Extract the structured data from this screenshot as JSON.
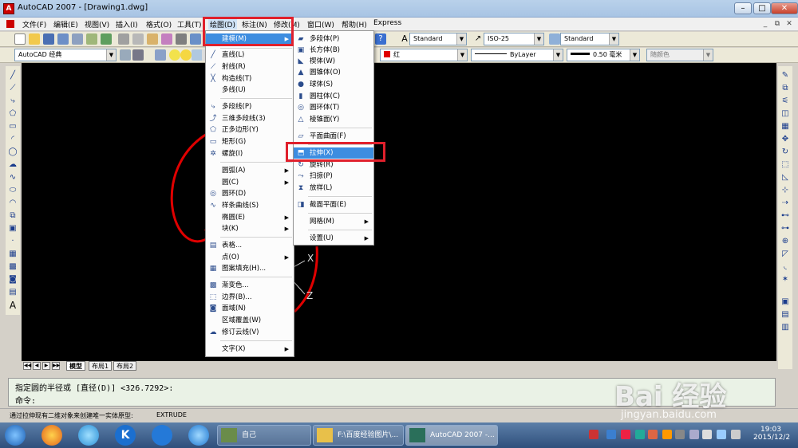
{
  "window": {
    "title": "AutoCAD 2007 - [Drawing1.dwg]",
    "app_icon": "A"
  },
  "menubar": {
    "items": [
      "文件(F)",
      "编辑(E)",
      "视图(V)",
      "插入(I)",
      "格式(O)",
      "工具(T)",
      "绘图(D)",
      "标注(N)",
      "修改(M)",
      "窗口(W)",
      "帮助(H)",
      "Express"
    ]
  },
  "toolbar2": {
    "text_style": "Standard",
    "dim_style": "ISO-25",
    "table_style": "Standard"
  },
  "toolbar3": {
    "workspace": "AutoCAD 经典",
    "color": "红",
    "linetype": "ByLayer",
    "lineweight": "0.50 毫米",
    "plotstyle": "随颜色",
    "colors": {
      "red_swatch": "#e00000"
    }
  },
  "draw_menu": {
    "items": [
      {
        "label": "建模(M)",
        "submenu": true,
        "icon": ""
      },
      {
        "label": "直线(L)",
        "icon": "line-icon"
      },
      {
        "label": "射线(R)",
        "icon": "ray-icon"
      },
      {
        "label": "构造线(T)",
        "icon": "xline-icon"
      },
      {
        "label": "多线(U)",
        "icon": ""
      },
      {
        "label": "多段线(P)",
        "icon": "polyline-icon"
      },
      {
        "label": "三维多段线(3)",
        "icon": "3dpoly-icon"
      },
      {
        "label": "正多边形(Y)",
        "icon": "polygon-icon"
      },
      {
        "label": "矩形(G)",
        "icon": "rectangle-icon"
      },
      {
        "label": "螺旋(I)",
        "icon": "helix-icon"
      },
      {
        "label": "圆弧(A)",
        "submenu": true,
        "icon": ""
      },
      {
        "label": "圆(C)",
        "submenu": true,
        "icon": ""
      },
      {
        "label": "圆环(D)",
        "icon": "donut-icon"
      },
      {
        "label": "样条曲线(S)",
        "icon": "spline-icon"
      },
      {
        "label": "椭圆(E)",
        "submenu": true,
        "icon": ""
      },
      {
        "label": "块(K)",
        "submenu": true,
        "icon": ""
      },
      {
        "label": "表格...",
        "icon": "table-icon"
      },
      {
        "label": "点(O)",
        "submenu": true,
        "icon": ""
      },
      {
        "label": "图案填充(H)...",
        "icon": "hatch-icon"
      },
      {
        "label": "渐变色...",
        "icon": "gradient-icon"
      },
      {
        "label": "边界(B)...",
        "icon": "boundary-icon"
      },
      {
        "label": "面域(N)",
        "icon": "region-icon"
      },
      {
        "label": "区域覆盖(W)",
        "icon": ""
      },
      {
        "label": "修订云线(V)",
        "icon": "revcloud-icon"
      },
      {
        "label": "文字(X)",
        "submenu": true,
        "icon": ""
      }
    ]
  },
  "model_submenu": {
    "items": [
      {
        "label": "多段体(P)"
      },
      {
        "label": "长方体(B)"
      },
      {
        "label": "楔体(W)"
      },
      {
        "label": "圆锥体(O)"
      },
      {
        "label": "球体(S)"
      },
      {
        "label": "圆柱体(C)"
      },
      {
        "label": "圆环体(T)"
      },
      {
        "label": "棱锥面(Y)"
      },
      {
        "label": "平面曲面(F)"
      },
      {
        "label": "拉伸(X)"
      },
      {
        "label": "旋转(R)"
      },
      {
        "label": "扫掠(P)"
      },
      {
        "label": "放样(L)"
      },
      {
        "label": "截面平面(E)"
      },
      {
        "label": "网格(M)",
        "submenu": true
      },
      {
        "label": "设置(U)",
        "submenu": true
      }
    ]
  },
  "tabs": [
    "模型",
    "布局1",
    "布局2"
  ],
  "command": {
    "line1": "指定圆的半径或 [直径(D)] <326.7292>:",
    "line2": "命令:"
  },
  "statusbar": {
    "hint": "通过拉伸现有二维对象来创建唯一实体原型:",
    "command": "EXTRUDE"
  },
  "taskbar": {
    "tasks": [
      "自己",
      "F:\\百度经验图片\\...",
      "AutoCAD 2007 -..."
    ],
    "time": "19:03",
    "date": "2015/12/2"
  },
  "axes": {
    "x": "X",
    "z": "Z"
  },
  "watermark": {
    "logo": "Bai 经验",
    "url": "jingyan.baidu.com"
  }
}
